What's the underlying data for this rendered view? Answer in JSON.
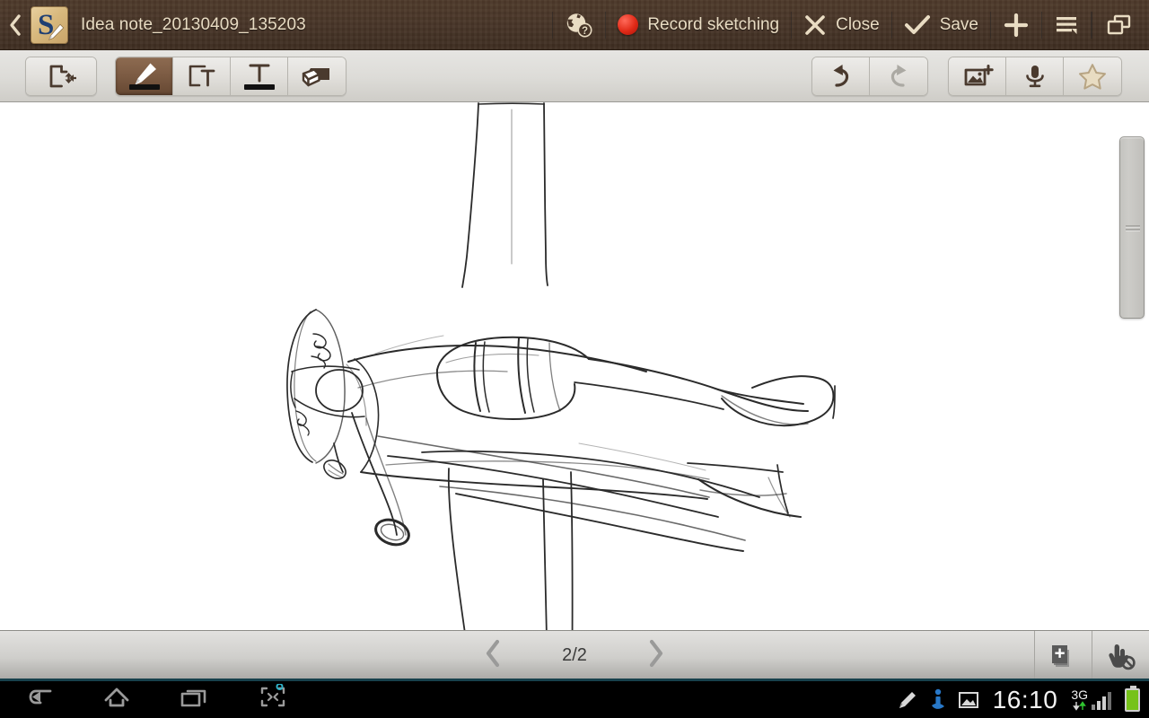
{
  "titlebar": {
    "back_icon": "chevron-left-icon",
    "app_icon": "s-note-app-icon",
    "title": "Idea note_20130409_135203",
    "help_icon": "globe-help-icon",
    "record_label": "Record sketching",
    "record_icon": "record-dot-icon",
    "close_label": "Close",
    "close_icon": "close-x-icon",
    "save_label": "Save",
    "save_icon": "checkmark-icon",
    "add_icon": "plus-icon",
    "menu_icon": "list-menu-icon",
    "multiwindow_icon": "multi-window-icon"
  },
  "toolbar": {
    "select_move": {
      "name": "select-move-tool",
      "icon": "page-move-icon",
      "active": false
    },
    "tools": [
      {
        "name": "pen-tool",
        "icon": "pen-icon",
        "active": true,
        "ink_color": "#111111"
      },
      {
        "name": "textbox-tool",
        "icon": "text-box-icon",
        "active": false
      },
      {
        "name": "text-tool",
        "icon": "text-format-icon",
        "active": false,
        "ink_color": "#111111"
      },
      {
        "name": "eraser-tool",
        "icon": "eraser-icon",
        "active": false
      }
    ],
    "undo": {
      "name": "undo-button",
      "icon": "undo-arrow-icon",
      "enabled": true
    },
    "redo": {
      "name": "redo-button",
      "icon": "redo-arrow-icon",
      "enabled": false
    },
    "insert_image": {
      "name": "insert-image-button",
      "icon": "image-plus-icon"
    },
    "voice": {
      "name": "voice-record-button",
      "icon": "microphone-icon"
    },
    "favorite": {
      "name": "favorite-button",
      "icon": "star-icon"
    }
  },
  "canvas": {
    "background": "#ffffff",
    "content_description": "hand-drawn pencil sketch of a propeller airplane",
    "stroke_color": "#2b2b2b",
    "scrollbar": {
      "name": "canvas-scrollbar",
      "position_pct": 7,
      "thumb_height_pct": 35
    }
  },
  "bottombar": {
    "prev_icon": "chevron-left-icon",
    "page_label": "2/2",
    "next_icon": "chevron-right-icon",
    "add_page_icon": "add-page-icon",
    "palm_reject_icon": "hand-disabled-icon"
  },
  "systembar": {
    "back_icon": "system-back-icon",
    "home_icon": "system-home-icon",
    "recents_icon": "system-recents-icon",
    "screenshot_icon": "screen-capture-icon",
    "status_icons": [
      "spen-icon",
      "spen-info-icon",
      "screenshot-saved-icon"
    ],
    "clock": "16:10",
    "network": "3G",
    "signal_icon": "signal-bars-icon",
    "battery_icon": "battery-full-icon"
  },
  "colors": {
    "titlebar_brown": "#483528",
    "active_tool_brown": "#7c5b43",
    "tan_text": "#e9dcc3",
    "toolbar_grey": "#dddcd8",
    "record_red": "#e02a17",
    "battery_green": "#76c21a",
    "teal_line": "#17414c"
  }
}
